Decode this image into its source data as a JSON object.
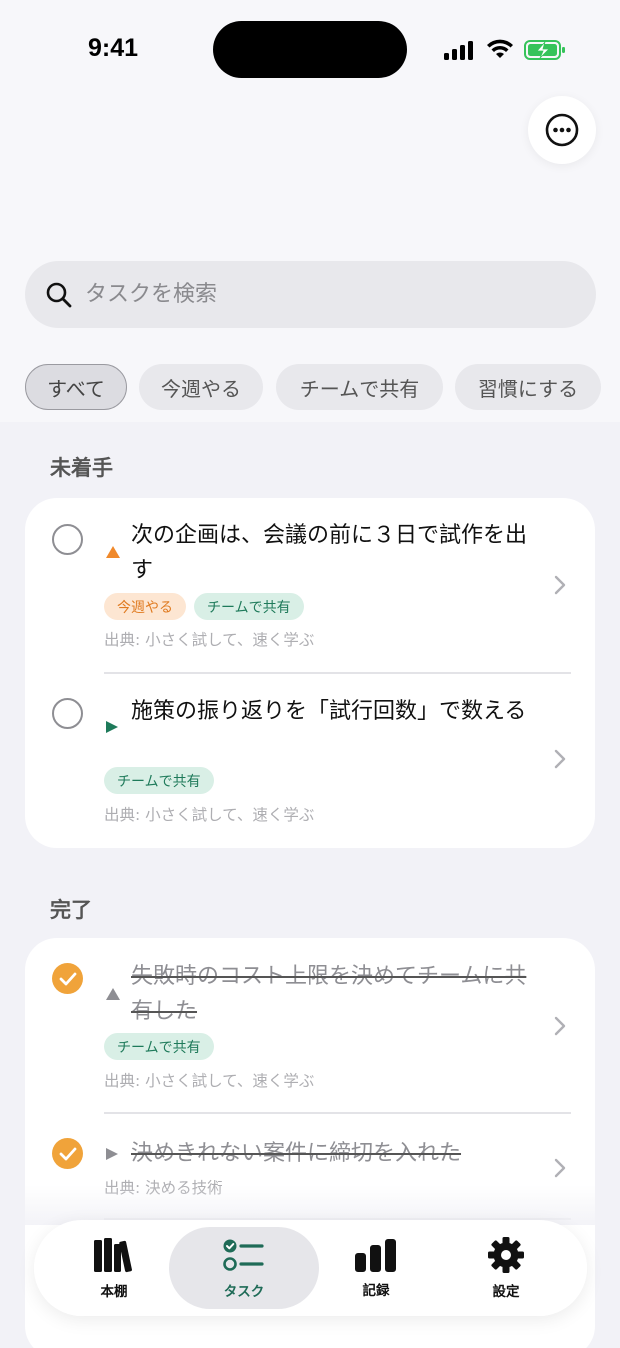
{
  "status_bar": {
    "time": "9:41"
  },
  "search": {
    "placeholder": "タスクを検索"
  },
  "filters": [
    "すべて",
    "今週やる",
    "チームで共有",
    "習慣にする"
  ],
  "sections": {
    "todo_title": "未着手",
    "done_title": "完了"
  },
  "todo_tasks": [
    {
      "title": "次の企画は、会議の前に３日で試作を出す",
      "tags": [
        "今週やる",
        "チームで共有"
      ],
      "source": "出典: 小さく試して、速く学ぶ",
      "priority_color": "#f0892b"
    },
    {
      "title": "施策の振り返りを「試行回数」で数える",
      "tags": [
        "チームで共有"
      ],
      "source": "出典: 小さく試して、速く学ぶ",
      "priority_color": "#1e7a5a"
    }
  ],
  "done_tasks": [
    {
      "title": "失敗時のコスト上限を決めてチームに共有した",
      "tags": [
        "チームで共有"
      ],
      "source": "出典: 小さく試して、速く学ぶ"
    },
    {
      "title": "決めきれない案件に締切を入れた",
      "source": "出典: 決める技術"
    }
  ],
  "tab_bar": {
    "items": [
      {
        "label": "本棚",
        "icon": "bookshelf-icon"
      },
      {
        "label": "タスク",
        "icon": "task-list-icon"
      },
      {
        "label": "記録",
        "icon": "bar-chart-icon"
      },
      {
        "label": "設定",
        "icon": "gear-icon"
      }
    ],
    "selected": "タスク"
  },
  "colors": {
    "accent": "#1f6b57",
    "done_check": "#f0a33a",
    "week_tag_bg": "#fde6d2",
    "team_tag_bg": "#d9efe6"
  }
}
